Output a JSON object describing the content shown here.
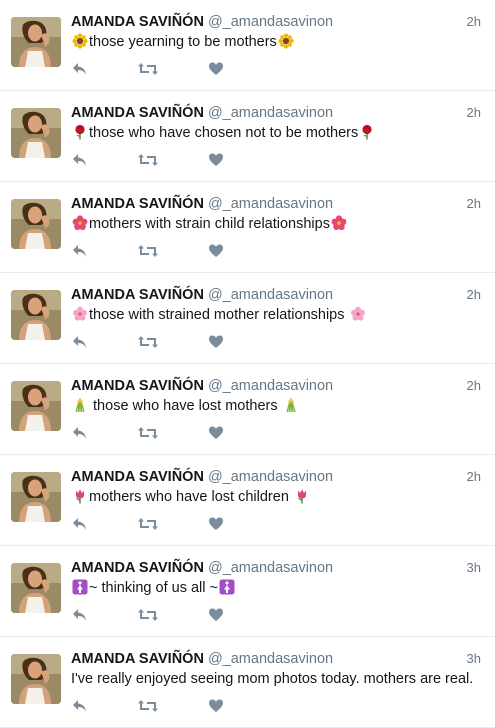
{
  "colors": {
    "name": "#14171a",
    "meta": "#657786",
    "icon": "#7b8d9c",
    "divider": "#e6ecf0"
  },
  "tweets": [
    {
      "author": "AMANDA SAVIÑÓN",
      "handle": "@_amandasavinon",
      "time": "2h",
      "emoji": "sunflower",
      "text": "those yearning to be mothers",
      "trailing_emoji": "sunflower"
    },
    {
      "author": "AMANDA SAVIÑÓN",
      "handle": "@_amandasavinon",
      "time": "2h",
      "emoji": "rose",
      "text": "those who have chosen not to be mothers",
      "trailing_emoji": "rose"
    },
    {
      "author": "AMANDA SAVIÑÓN",
      "handle": "@_amandasavinon",
      "time": "2h",
      "emoji": "hibiscus",
      "text": "mothers with strain child relationships",
      "trailing_emoji": "hibiscus"
    },
    {
      "author": "AMANDA SAVIÑÓN",
      "handle": "@_amandasavinon",
      "time": "2h",
      "emoji": "cherry-blossom",
      "text": "those with strained mother relationships",
      "trailing_emoji": "cherry-blossom"
    },
    {
      "author": "AMANDA SAVIÑÓN",
      "handle": "@_amandasavinon",
      "time": "2h",
      "emoji": "sheaf-of-rice",
      "text": "those who have lost mothers",
      "trailing_emoji": "sheaf-of-rice"
    },
    {
      "author": "AMANDA SAVIÑÓN",
      "handle": "@_amandasavinon",
      "time": "2h",
      "emoji": "tulip",
      "text": "mothers who have lost children",
      "trailing_emoji": "tulip"
    },
    {
      "author": "AMANDA SAVIÑÓN",
      "handle": "@_amandasavinon",
      "time": "3h",
      "emoji": "womens-symbol",
      "text": "~ thinking of us all ~",
      "trailing_emoji": "womens-symbol"
    },
    {
      "author": "AMANDA SAVIÑÓN",
      "handle": "@_amandasavinon",
      "time": "3h",
      "emoji": "",
      "text": "I've really enjoyed seeing mom photos today. mothers are real.",
      "trailing_emoji": ""
    }
  ],
  "actions": {
    "reply_icon": "reply-icon",
    "retweet_icon": "retweet-icon",
    "like_icon": "heart-icon"
  }
}
